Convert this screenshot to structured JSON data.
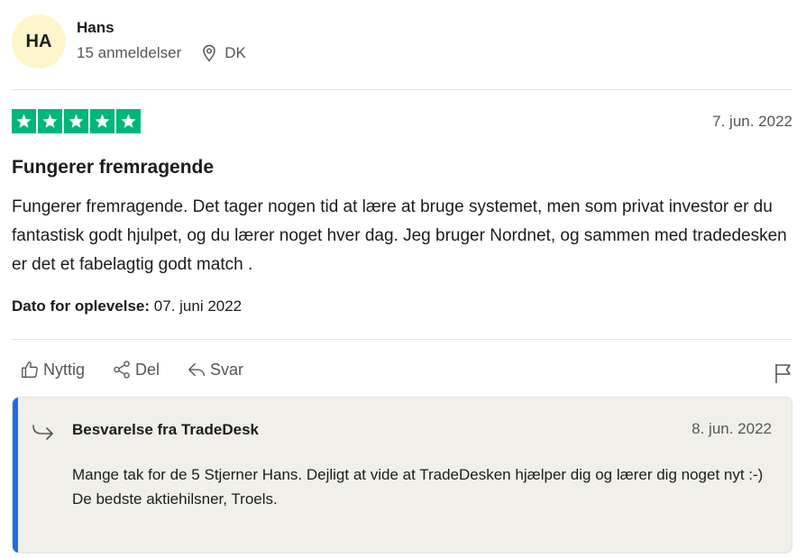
{
  "reviewer": {
    "initials": "HA",
    "name": "Hans",
    "review_count": "15 anmeldelser",
    "country": "DK"
  },
  "review": {
    "rating": 5,
    "rating_color": "#00b67a",
    "date": "7. jun. 2022",
    "title": "Fungerer fremragende",
    "body": "Fungerer fremragende. Det tager nogen tid at lære at bruge systemet, men som privat investor er du fantastisk godt hjulpet, og du lærer noget hver dag. Jeg bruger Nordnet, og sammen med tradedesken er det et fabelagtig godt match .",
    "experience_label": "Dato for oplevelse:",
    "experience_date": "07. juni 2022"
  },
  "actions": {
    "useful": "Nyttig",
    "share": "Del",
    "reply": "Svar"
  },
  "reply": {
    "author": "Besvarelse fra TradeDesk",
    "date": "8. jun. 2022",
    "line1": "Mange tak for de 5 Stjerner Hans. Dejligt at vide at TradeDesken hjælper dig og lærer dig noget nyt :-)",
    "line2": "De bedste aktiehilsner, Troels.",
    "accent_color": "#1b6ee2"
  }
}
